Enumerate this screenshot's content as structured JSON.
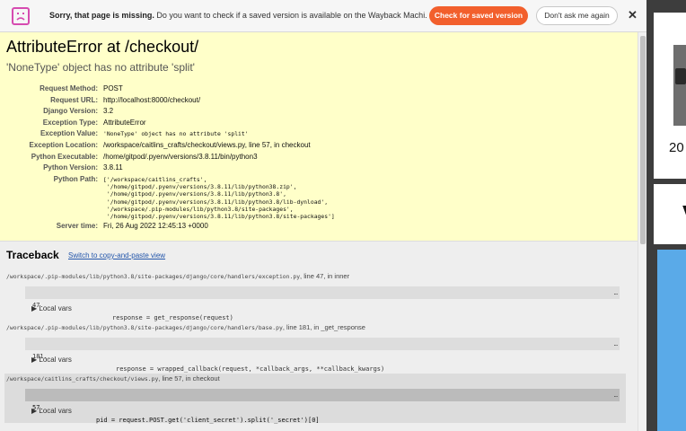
{
  "wayback_bar": {
    "icon": "sad-face-icon",
    "message_bold": "Sorry, that page is missing.",
    "message_rest": " Do you want to check if a saved version is available on the Wayback Machi...",
    "check_button": "Check for saved version",
    "dont_ask_button": "Don't ask me again",
    "close": "✕",
    "accent_color": "#f25f2c",
    "icon_color": "#d64bb0"
  },
  "error": {
    "title": "AttributeError at /checkout/",
    "subtitle": "'NoneType' object has no attribute 'split'"
  },
  "meta": {
    "request_method": {
      "label": "Request Method:",
      "value": "POST"
    },
    "request_url": {
      "label": "Request URL:",
      "value": "http://localhost:8000/checkout/"
    },
    "django_version": {
      "label": "Django Version:",
      "value": "3.2"
    },
    "exception_type": {
      "label": "Exception Type:",
      "value": "AttributeError"
    },
    "exception_value": {
      "label": "Exception Value:",
      "value": "'NoneType' object has no attribute 'split'"
    },
    "exception_location": {
      "label": "Exception Location:",
      "value": "/workspace/caitlins_crafts/checkout/views.py, line 57, in checkout"
    },
    "python_executable": {
      "label": "Python Executable:",
      "value": "/home/gitpod/.pyenv/versions/3.8.11/bin/python3"
    },
    "python_version": {
      "label": "Python Version:",
      "value": "3.8.11"
    },
    "python_path": {
      "label": "Python Path:",
      "value": "['/workspace/caitlins_crafts',\n '/home/gitpod/.pyenv/versions/3.8.11/lib/python38.zip',\n '/home/gitpod/.pyenv/versions/3.8.11/lib/python3.8',\n '/home/gitpod/.pyenv/versions/3.8.11/lib/python3.8/lib-dynload',\n '/workspace/.pip-modules/lib/python3.8/site-packages',\n '/home/gitpod/.pyenv/versions/3.8.11/lib/python3.8/site-packages']"
    },
    "server_time": {
      "label": "Server time:",
      "value": "Fri, 26 Aug 2022 12:45:13 +0000"
    }
  },
  "traceback": {
    "title": "Traceback",
    "switch_link": "Switch to copy-and-paste view",
    "local_vars_label": "▶ Local vars",
    "frames": [
      {
        "path": "/workspace/.pip-modules/lib/python3.8/site-packages/django/core/handlers/exception.py",
        "suffix": ", line 47, in inner",
        "line_no": "47.",
        "code": "response = get_response(request)",
        "dots": "…"
      },
      {
        "path": "/workspace/.pip-modules/lib/python3.8/site-packages/django/core/handlers/base.py",
        "suffix": ", line 181, in _get_response",
        "line_no": "181.",
        "code": "response = wrapped_callback(request, *callback_args, **callback_kwargs)",
        "dots": "…"
      },
      {
        "path": "/workspace/caitlins_crafts/checkout/views.py",
        "suffix": ", line 57, in checkout",
        "line_no": "57.",
        "code": "pid = request.POST.get('client_secret').split('_secret')[0]",
        "dots": "…"
      }
    ]
  },
  "background": {
    "year_fragment": "20",
    "letter_fragment": "V"
  }
}
